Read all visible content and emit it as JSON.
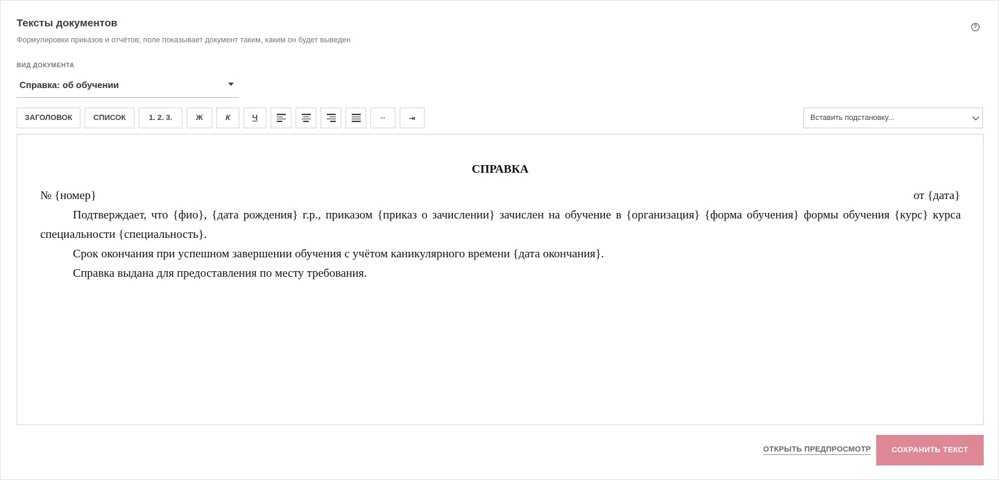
{
  "header": {
    "title": "Тексты документов",
    "subtitle": "Формулировки приказов и отчётов; поле показывает документ таким, каким он будет выведен",
    "help_glyph": "?"
  },
  "doc_type": {
    "label": "ВИД ДОКУМЕНТА",
    "selected": "Справка: об обучении"
  },
  "toolbar": {
    "heading": "ЗАГОЛОВОК",
    "list": "СПИСОК",
    "numbered": "1. 2. 3.",
    "bold": "Ж",
    "italic": "К",
    "underline": "Ч",
    "indent_both": "⇔",
    "indent": "⇥",
    "substitution_placeholder": "Вставить подстановку..."
  },
  "document": {
    "heading": "СПРАВКА",
    "number_line": "№ {номер}",
    "date_line": "от {дата}",
    "paragraphs": [
      "Подтверждает, что {фио}, {дата рождения} г.р., приказом {приказ о зачислении} зачислен на обучение в {организация} {форма обучения} формы обучения {курс} курса специальности {специальность}.",
      "Срок окончания при успешном завершении обучения с учётом каникулярного времени {дата окончания}.",
      "Справка выдана для предоставления по месту требования."
    ]
  },
  "footer": {
    "preview_label": "ОТКРЫТЬ ПРЕДПРОСМОТР",
    "save_label": "СОХРАНИТЬ ТЕКСТ"
  },
  "colors": {
    "accent": "#de8795",
    "border": "#d8d8d8",
    "text": "#333333"
  }
}
